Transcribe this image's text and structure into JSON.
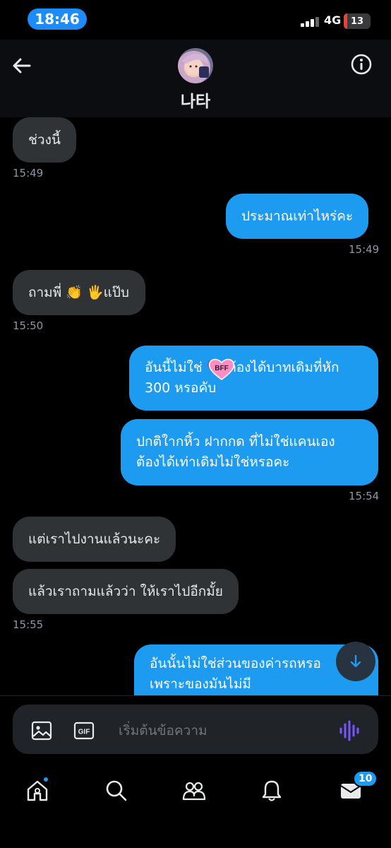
{
  "status_bar": {
    "time": "18:46",
    "network": "4G",
    "battery": "13",
    "battery_level": 0.13
  },
  "header": {
    "contact_name": "나타"
  },
  "messages": [
    {
      "text": "ช่วงนี้"
    },
    {
      "text": "ประมาณเท่าไหร่คะ"
    },
    {
      "text": "ถามพี่ 👏 🖐แป๊บ"
    },
    {
      "line1": "อันนี้ไม่ใช่ 💗 ต้องได้บาทเดิมที่หัก",
      "line2": "300 หรอคับ"
    },
    {
      "line1": "ปกติใากหิ้ว ฝากกด ที่ไม่ใช่แคนเอง",
      "line2": "ต้องได้เท่าเดิมไม่ใช่หรอคะ"
    },
    {
      "text": "แต่เราไปงานแล้วนะคะ"
    },
    {
      "text": "แล้วเราถามแล้วว่า ให้เราไปอีกมั้ย"
    },
    {
      "line1": "อันนั้นไม่ใช่ส่วนของค่ารถหรอ",
      "line2": "เพราะของมันไม่มี"
    }
  ],
  "timestamps": [
    "15:49",
    "15:49",
    "15:50",
    "15:54",
    "15:55"
  ],
  "emoji": {
    "clap": "👏",
    "hand": "✋",
    "bff": "BFF"
  },
  "composer": {
    "placeholder": "เริ่มต้นข้อความ",
    "gif_label": "GIF"
  },
  "nav": {
    "messages_badge": "10"
  },
  "colors": {
    "accent": "#1d9bf0",
    "incoming_bubble": "#2f3336",
    "battery_low": "#ff3b30",
    "voice": "#7856ff"
  }
}
